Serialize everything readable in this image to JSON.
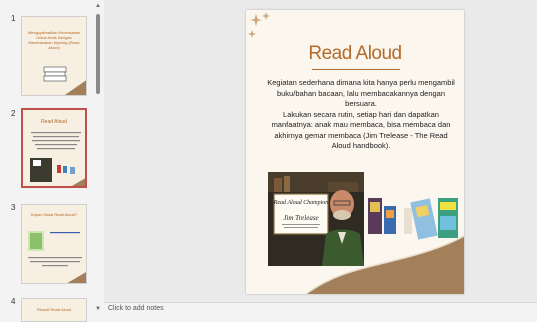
{
  "thumbnails": [
    {
      "number": "1",
      "title": "Mengoptimalkan Kecerdasan Untuk Anak Dengan Membacakan Nyaring (Read Aloud)"
    },
    {
      "number": "2",
      "title": "Read Aloud"
    },
    {
      "number": "3",
      "title": "Kapan Mulai Read Aloud?"
    },
    {
      "number": "4",
      "title": "Filosofi Read Aloud"
    }
  ],
  "slide": {
    "title": "Read Aloud",
    "paragraph_1": "Kegiatan sederhana dimana kita hanya perlu mengambil buku/bahan bacaan, lalu membacakannya dengan bersuara.",
    "paragraph_2": "Lakukan secara rutin, setiap hari dan dapatkan manfaatnya: anak mau membaca, bisa membaca dan akhirnya gemar membaca (Jim Trelease - The Read Aloud handbook).",
    "certificate_title": "Read Aloud Champion",
    "certificate_name": "Jim Trelease"
  },
  "notes": {
    "placeholder": "Click to add notes"
  },
  "colors": {
    "accent": "#b46a28",
    "selected_border": "#c0504d"
  }
}
